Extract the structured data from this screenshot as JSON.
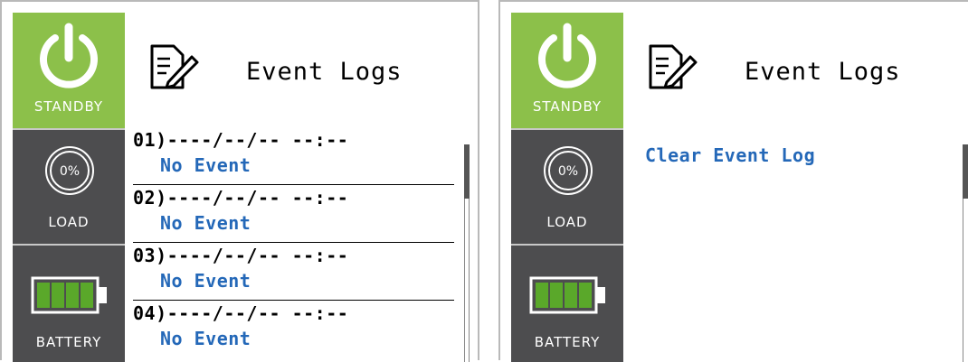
{
  "left_screen": {
    "sidebar": {
      "standby_label": "STANDBY",
      "load_label": "LOAD",
      "load_value": "0%",
      "battery_label": "BATTERY"
    },
    "header": {
      "title": "Event Logs"
    },
    "logs": [
      {
        "time": "01)----/--/-- --:--",
        "event": "No Event"
      },
      {
        "time": "02)----/--/-- --:--",
        "event": "No Event"
      },
      {
        "time": "03)----/--/-- --:--",
        "event": "No Event"
      },
      {
        "time": "04)----/--/-- --:--",
        "event": "No Event"
      }
    ]
  },
  "right_screen": {
    "sidebar": {
      "standby_label": "STANDBY",
      "load_label": "LOAD",
      "load_value": "0%",
      "battery_label": "BATTERY"
    },
    "header": {
      "title": "Event Logs"
    },
    "menu": {
      "clear_label": "Clear Event Log"
    }
  },
  "colors": {
    "standby_green": "#8cc04a",
    "sidebar_gray": "#4d4d4f",
    "battery_green": "#5aa82a",
    "event_blue": "#2468b8"
  },
  "icons": [
    "power-icon",
    "load-gauge-icon",
    "battery-icon",
    "edit-document-icon"
  ]
}
